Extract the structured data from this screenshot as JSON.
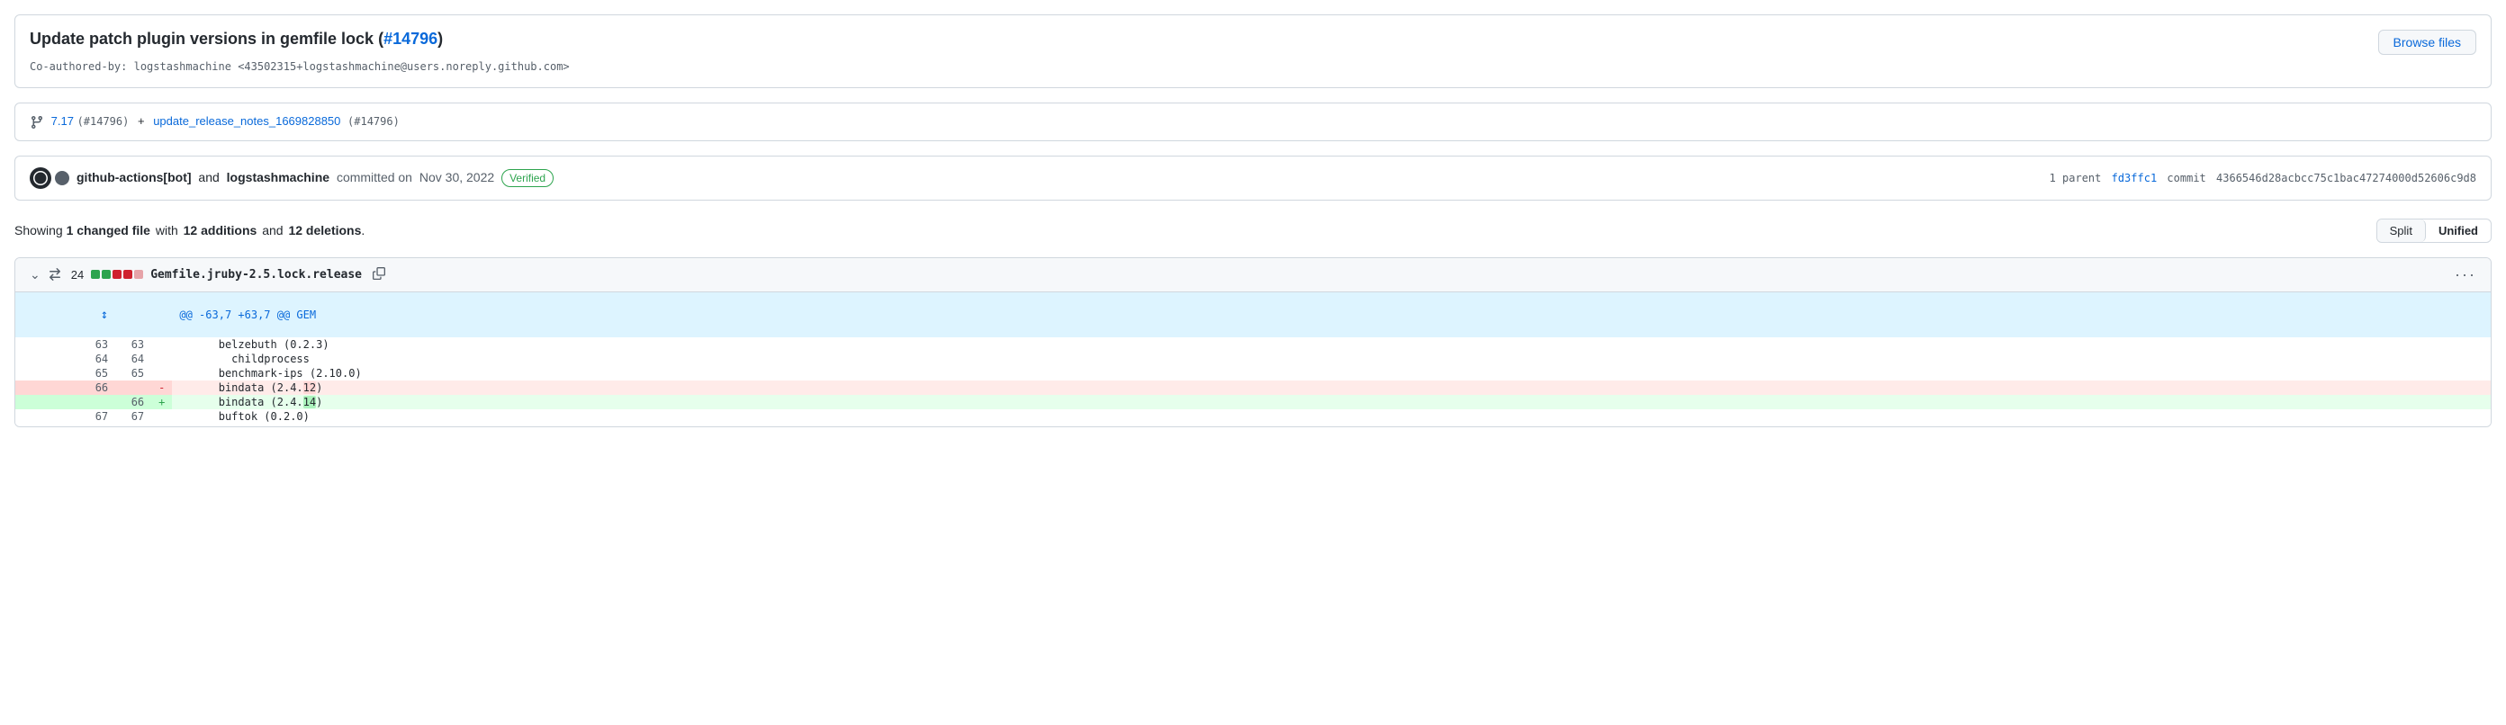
{
  "commit": {
    "title": "Update patch plugin versions in gemfile lock",
    "issue_link_text": "#14796",
    "issue_link_href": "#14796",
    "subtitle": "Co-authored-by: logstashmachine <43502315+logstashmachine@users.noreply.github.com>",
    "browse_files_label": "Browse files"
  },
  "branches": {
    "version": "7.17",
    "version_issue": "(#14796)",
    "separator": "+",
    "branch_name": "update_release_notes_1669828850",
    "branch_issue": "(#14796)"
  },
  "author": {
    "bot_name": "github-actions[bot]",
    "conjunction": "and",
    "user_name": "logstashmachine",
    "action": "committed on",
    "date": "Nov 30, 2022",
    "verified_label": "Verified",
    "parent_label": "1 parent",
    "parent_hash": "fd3ffc1",
    "commit_label": "commit",
    "commit_hash": "4366546d28acbcc75c1bac47274000d52606c9d8"
  },
  "stats": {
    "showing_label": "Showing",
    "changed_count": "1 changed file",
    "with_label": "with",
    "additions": "12 additions",
    "and_label": "and",
    "deletions": "12 deletions",
    "period": ".",
    "split_label": "Split",
    "unified_label": "Unified"
  },
  "diff": {
    "file": {
      "change_count": "24",
      "filename": "Gemfile.jruby-2.5.lock.release",
      "more_icon": "···"
    },
    "hunk_header": "@@ -63,7 +63,7 @@ GEM",
    "lines": [
      {
        "old_num": "63",
        "new_num": "63",
        "sign": "",
        "content": "      belzebuth (0.2.3)",
        "type": "context"
      },
      {
        "old_num": "64",
        "new_num": "64",
        "sign": "",
        "content": "        childprocess",
        "type": "context"
      },
      {
        "old_num": "65",
        "new_num": "65",
        "sign": "",
        "content": "      benchmark-ips (2.10.0)",
        "type": "context"
      },
      {
        "old_num": "66",
        "new_num": "",
        "sign": "-",
        "content": "      bindata (2.4.",
        "highlight": "12",
        "after": ")",
        "type": "removed"
      },
      {
        "old_num": "",
        "new_num": "66",
        "sign": "+",
        "content": "      bindata (2.4.",
        "highlight": "14",
        "after": ")",
        "type": "added"
      },
      {
        "old_num": "67",
        "new_num": "67",
        "sign": "",
        "content": "      buftok (0.2.0)",
        "type": "context"
      }
    ]
  }
}
